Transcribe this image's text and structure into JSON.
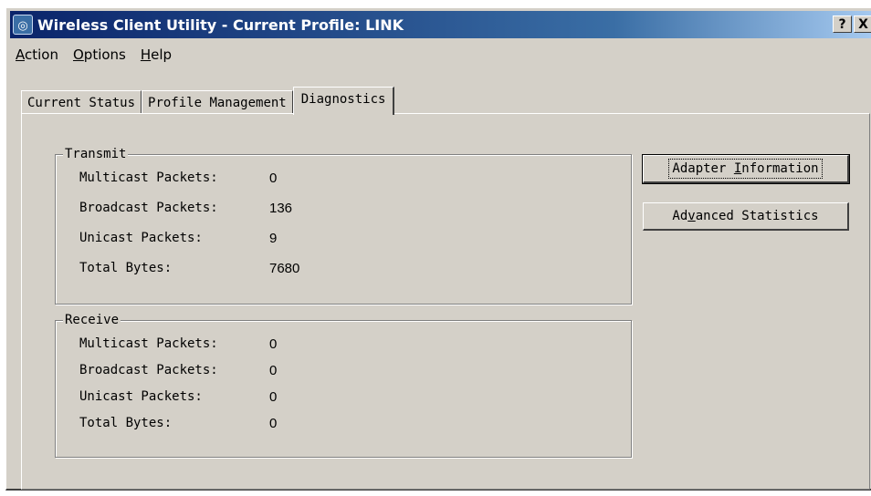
{
  "window": {
    "title": "Wireless Client Utility - Current Profile: LINK",
    "help_button": "?",
    "close_button": "X"
  },
  "menu": {
    "items": [
      "Action",
      "Options",
      "Help"
    ]
  },
  "tabs": [
    "Current Status",
    "Profile Management",
    "Diagnostics"
  ],
  "active_tab": "Diagnostics",
  "transmit": {
    "title": "Transmit",
    "rows": [
      {
        "label": "Multicast Packets:",
        "value": "0"
      },
      {
        "label": "Broadcast Packets:",
        "value": "136"
      },
      {
        "label": "Unicast Packets:",
        "value": "9"
      },
      {
        "label": "Total Bytes:",
        "value": "7680"
      }
    ]
  },
  "receive": {
    "title": "Receive",
    "rows": [
      {
        "label": "Multicast Packets:",
        "value": "0"
      },
      {
        "label": "Broadcast Packets:",
        "value": "0"
      },
      {
        "label": "Unicast Packets:",
        "value": "0"
      },
      {
        "label": "Total Bytes:",
        "value": "0"
      }
    ]
  },
  "buttons": {
    "adapter_pre": "Adapter ",
    "adapter_ul": "I",
    "adapter_post": "nformation",
    "advanced_pre": "Ad",
    "advanced_ul": "v",
    "advanced_post": "anced Statistics"
  },
  "icons": {
    "app": "wireless-signal-icon"
  }
}
